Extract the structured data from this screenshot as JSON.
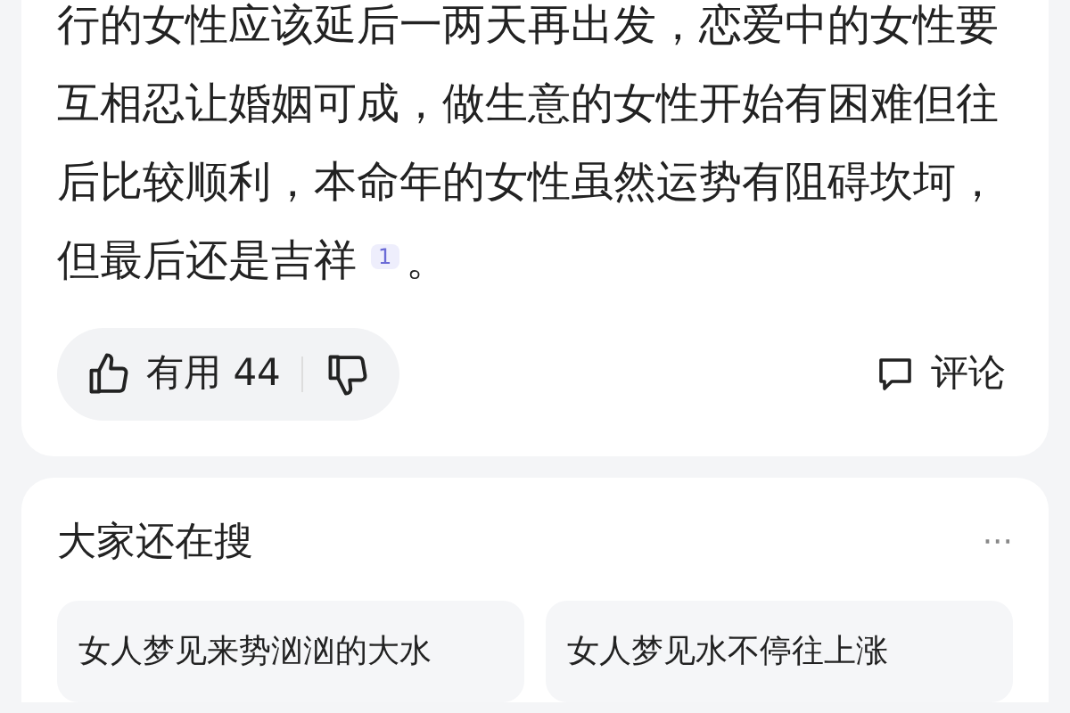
{
  "answer": {
    "text": "行的女性应该延后一两天再出发，恋爱中的女性要互相忍让婚姻可成，做生意的女性开始有困难但往后比较顺利，本命年的女性虽然运势有阻碍坎坷，但最后还是吉祥",
    "footnote": "1",
    "end": "。"
  },
  "actions": {
    "useful_label": "有用",
    "useful_count": "44",
    "comment_label": "评论"
  },
  "related": {
    "title": "大家还在搜",
    "more": "···",
    "items": [
      "女人梦见来势汹汹的大水",
      "女人梦见水不停往上涨"
    ]
  }
}
